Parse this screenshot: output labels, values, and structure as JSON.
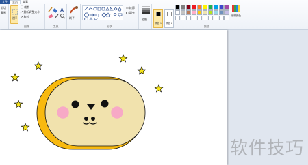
{
  "ribbon": {
    "tabs": [
      {
        "label": "文件"
      },
      {
        "label": "主页"
      },
      {
        "label": "查看"
      }
    ],
    "clipboard": {
      "paste": "粘贴",
      "cut": "剪切",
      "copy": "复制",
      "label": "剪贴板"
    },
    "image": {
      "select": "选择",
      "crop": "裁剪",
      "resize": "重新调整大小",
      "rotate": "旋转",
      "label": "图像"
    },
    "tools": {
      "label": "工具"
    },
    "brushes": {
      "label": "刷子"
    },
    "shapes": {
      "outline": "轮廓",
      "fill": "填充",
      "label": "形状"
    },
    "size": {
      "label": "粗细"
    },
    "colors": {
      "color1": "颜色 1",
      "color2": "颜色 2",
      "edit": "编辑颜色",
      "label": "颜色",
      "color1_value": "#000000",
      "color2_value": "#ffffff",
      "palette": [
        "#000000",
        "#7f7f7f",
        "#880015",
        "#ed1c24",
        "#ff7f27",
        "#fff200",
        "#22b14c",
        "#00a2e8",
        "#3f48cc",
        "#a349a4",
        "#ffffff",
        "#c3c3c3",
        "#b97a57",
        "#ffaec9",
        "#ffc90e",
        "#efe4b0",
        "#b5e61d",
        "#99d9ea",
        "#7092be",
        "#c8bfe7",
        "#ffffff",
        "#ffffff",
        "#ffffff",
        "#ffffff",
        "#ffffff",
        "#ffffff",
        "#ffffff",
        "#ffffff",
        "#ffffff",
        "#ffffff"
      ]
    }
  },
  "drawing": {
    "star_color": "#f5e31a",
    "face_outer_color": "#f8b90f",
    "face_inner_color": "#f1e2ad",
    "cheek_color": "#f7a9c6",
    "outline_color": "#111111"
  },
  "watermark": "软件技巧"
}
